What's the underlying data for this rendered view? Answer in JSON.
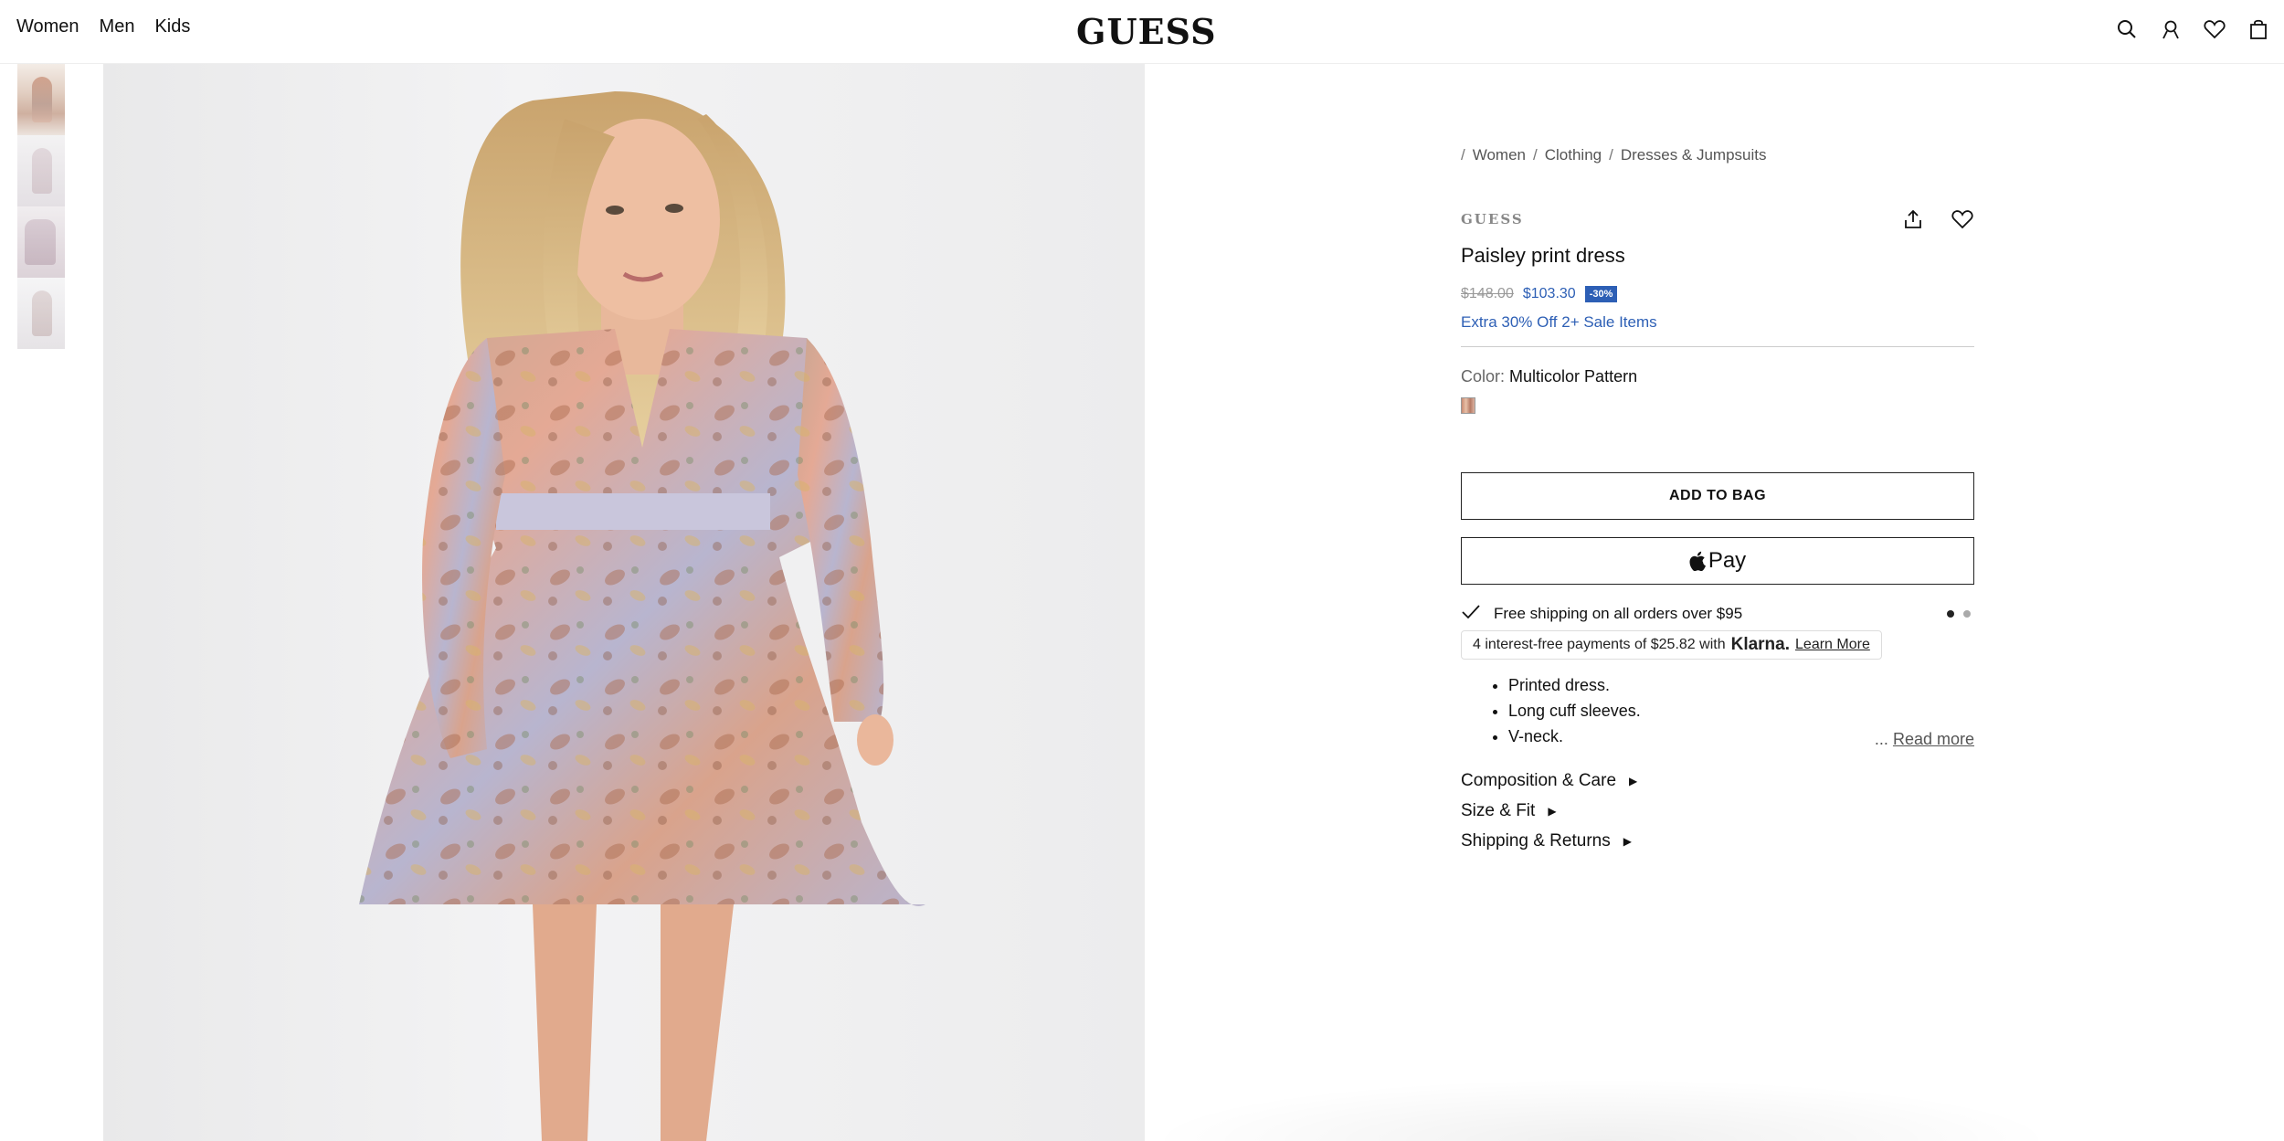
{
  "header": {
    "nav": [
      "Women",
      "Men",
      "Kids"
    ],
    "logo": "GUESS",
    "icons": [
      "search-icon",
      "account-icon",
      "wishlist-icon",
      "bag-icon"
    ]
  },
  "gallery": {
    "thumbnail_count": 4
  },
  "breadcrumb": [
    "Women",
    "Clothing",
    "Dresses & Jumpsuits"
  ],
  "product": {
    "brand": "GUESS",
    "title": "Paisley print dress",
    "price_original": "$148.00",
    "price_sale": "$103.30",
    "discount_badge": "-30%",
    "promo": "Extra 30% Off 2+ Sale Items",
    "color_label": "Color:",
    "color_value": "Multicolor Pattern",
    "add_to_bag": "ADD TO BAG",
    "pay_label": "Pay",
    "shipping": "Free shipping on all orders over $95",
    "klarna_text": "4 interest-free payments of $25.82 with",
    "klarna_brand": "Klarna.",
    "klarna_link": "Learn More",
    "description": [
      "Printed dress.",
      "Long cuff sleeves.",
      "V-neck."
    ],
    "read_more_prefix": "...",
    "read_more": "Read more",
    "accordion": [
      "Composition & Care",
      "Size & Fit",
      "Shipping & Returns"
    ]
  },
  "colors": {
    "accent": "#2d5fb5",
    "text": "#111111"
  }
}
